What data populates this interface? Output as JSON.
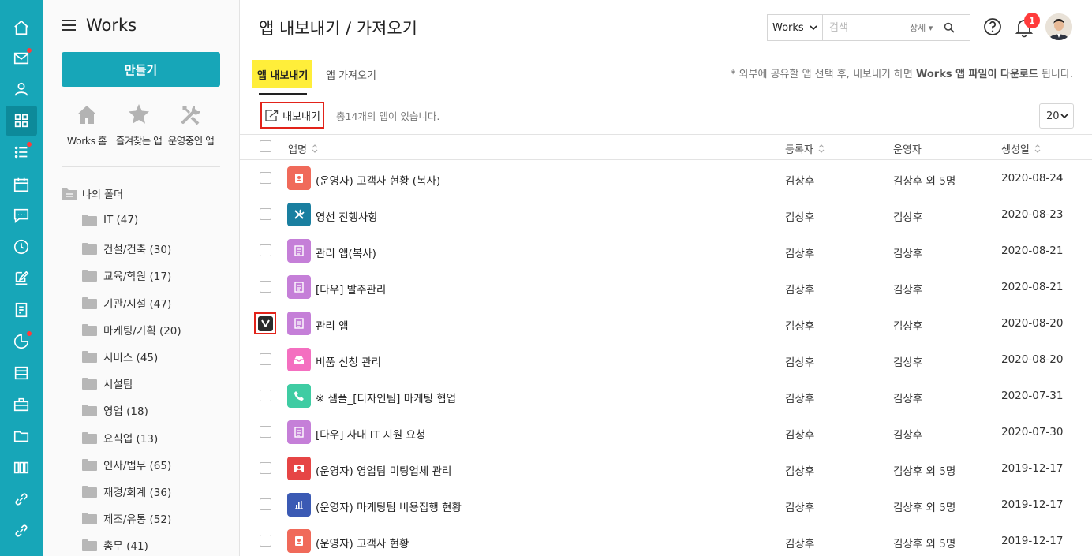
{
  "sidebar": {
    "title": "Works",
    "create_label": "만들기",
    "quick_links": [
      {
        "label": "Works 홈",
        "icon": "house-icon"
      },
      {
        "label": "즐겨찾는 앱",
        "icon": "star-icon"
      },
      {
        "label": "운영중인 앱",
        "icon": "tools-icon"
      }
    ],
    "root_folder": "나의 폴더",
    "folders": [
      "IT (47)",
      "건설/건축 (30)",
      "교육/학원 (17)",
      "기관/시설 (47)",
      "마케팅/기획 (20)",
      "서비스 (45)",
      "시설팀",
      "영업 (18)",
      "요식업 (13)",
      "인사/법무 (65)",
      "재경/회계 (36)",
      "제조/유통 (52)",
      "총무 (41)"
    ]
  },
  "rail": {
    "icons": [
      "home-icon",
      "mail-icon",
      "contacts-icon",
      "apps-icon",
      "tasks-icon",
      "calendar-icon",
      "chat-icon",
      "clock-icon",
      "edit-icon",
      "form-icon",
      "chart-icon",
      "list-icon",
      "briefcase-icon",
      "folder-icon",
      "building-icon",
      "link-icon",
      "link-icon"
    ],
    "dots": [
      1,
      4,
      10
    ]
  },
  "header": {
    "page_title": "앱 내보내기 / 가져오기",
    "search_scope": "Works",
    "search_placeholder": "검색",
    "search_detail": "상세",
    "notification_count": "1"
  },
  "tabs": [
    {
      "label": "앱 내보내기",
      "active": true
    },
    {
      "label": "앱 가져오기",
      "active": false
    }
  ],
  "notice": {
    "prefix": "* 외부에 공유할 앱 선택 후, 내보내기 하면 ",
    "bold": "Works 앱 파일이 다운로드",
    "suffix": " 됩니다."
  },
  "toolbar": {
    "export_label": "내보내기",
    "count_text": "총14개의 앱이 있습니다.",
    "per_page": "20"
  },
  "table": {
    "columns": [
      "앱명",
      "등록자",
      "운영자",
      "생성일"
    ],
    "rows": [
      {
        "name": "(운영자) 고객사 현황 (복사)",
        "registrant": "김상후",
        "operator": "김상후 외 5명",
        "date": "2020-08-24",
        "icon": "contact-card-icon",
        "color": "#f06a5a",
        "checked": false
      },
      {
        "name": "영선 진행사항",
        "registrant": "김상후",
        "operator": "김상후",
        "date": "2020-08-23",
        "icon": "tools-icon",
        "color": "#1a7fa0",
        "checked": false
      },
      {
        "name": "관리 앱(복사)",
        "registrant": "김상후",
        "operator": "김상후",
        "date": "2020-08-21",
        "icon": "document-icon",
        "color": "#c57fd8",
        "checked": false
      },
      {
        "name": "[다우] 발주관리",
        "registrant": "김상후",
        "operator": "김상후",
        "date": "2020-08-21",
        "icon": "document-icon",
        "color": "#c57fd8",
        "checked": false
      },
      {
        "name": "관리 앱",
        "registrant": "김상후",
        "operator": "김상후",
        "date": "2020-08-20",
        "icon": "document-icon",
        "color": "#c57fd8",
        "checked": true
      },
      {
        "name": "비품 신청 관리",
        "registrant": "김상후",
        "operator": "김상후",
        "date": "2020-08-20",
        "icon": "inbox-icon",
        "color": "#f46fc0",
        "checked": false
      },
      {
        "name": "※ 샘플_[디자인팀] 마케팅 협업",
        "registrant": "김상후",
        "operator": "김상후",
        "date": "2020-07-31",
        "icon": "phone-icon",
        "color": "#3fcca3",
        "checked": false
      },
      {
        "name": "[다우] 사내 IT 지원 요청",
        "registrant": "김상후",
        "operator": "김상후",
        "date": "2020-07-30",
        "icon": "document-icon",
        "color": "#c57fd8",
        "checked": false
      },
      {
        "name": "(운영자) 영업팀 미팅업체 관리",
        "registrant": "김상후",
        "operator": "김상후 외 5명",
        "date": "2019-12-17",
        "icon": "person-card-icon",
        "color": "#e64545",
        "checked": false
      },
      {
        "name": "(운영자) 마케팅팀 비용집행 현황",
        "registrant": "김상후",
        "operator": "김상후 외 5명",
        "date": "2019-12-17",
        "icon": "bar-chart-icon",
        "color": "#3b5ab4",
        "checked": false
      },
      {
        "name": "(운영자) 고객사 현황",
        "registrant": "김상후",
        "operator": "김상후 외 5명",
        "date": "2019-12-17",
        "icon": "contact-card-icon",
        "color": "#f06a5a",
        "checked": false
      }
    ]
  },
  "colors": {
    "accent": "#17a6b8",
    "highlight": "#ffee3a",
    "alert": "#e2231a"
  }
}
